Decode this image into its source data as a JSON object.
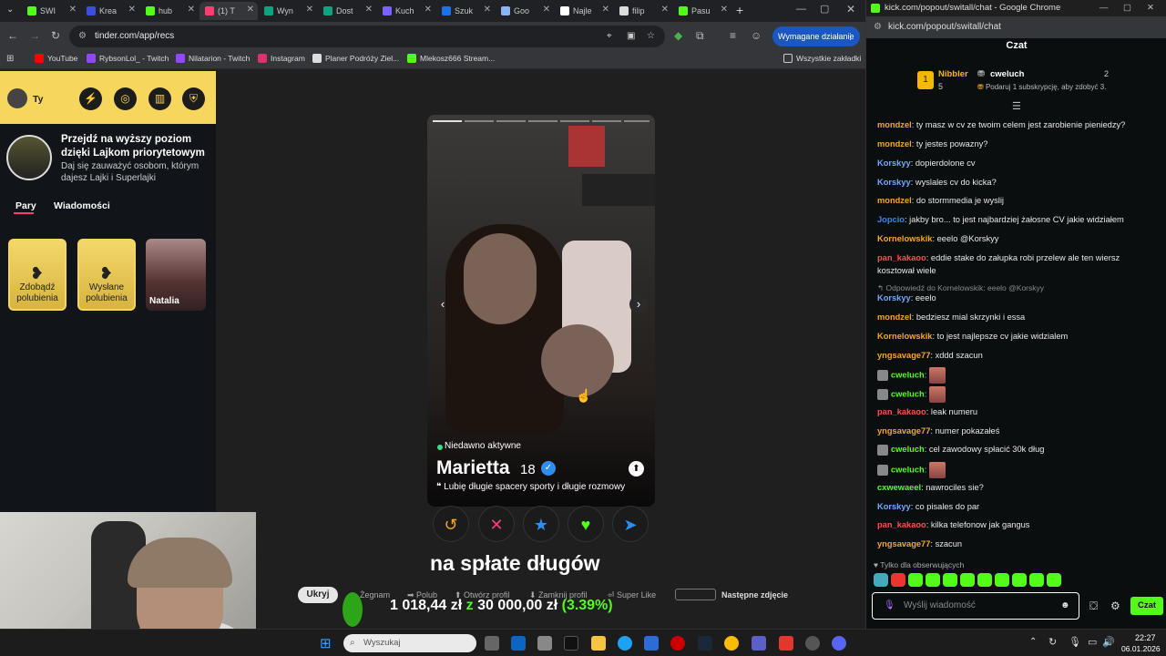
{
  "browser": {
    "tabs": [
      {
        "label": "SWI",
        "color": "#53fc18"
      },
      {
        "label": "Krea",
        "color": "#3c4ee0"
      },
      {
        "label": "hub",
        "color": "#53fc18"
      },
      {
        "label": "(1) T",
        "color": "#fe3c72"
      },
      {
        "label": "Wyn",
        "color": "#10a37f"
      },
      {
        "label": "Dost",
        "color": "#10a37f"
      },
      {
        "label": "Kuch",
        "color": "#7b61ff"
      },
      {
        "label": "Szuk",
        "color": "#1a73e8"
      },
      {
        "label": "Goo",
        "color": "#8ab4f8"
      },
      {
        "label": "Najle",
        "color": "#ffffff"
      },
      {
        "label": "filip",
        "color": "#dddddd"
      },
      {
        "label": "Pasu",
        "color": "#53fc18"
      }
    ],
    "url": "tinder.com/app/recs",
    "action_button": "Wymagane działanie",
    "bookmarks": [
      "YouTube",
      "RybsonLol_ - Twitch",
      "Nilatarion - Twitch",
      "Instagram",
      "Planer Podróży Ziel...",
      "Mlekosz666 Stream..."
    ],
    "all_bookmarks": "Wszystkie zakładki"
  },
  "tinder": {
    "user_label": "Ty",
    "promo_title": "Przejdź na wyższy poziom dzięki Lajkom priorytetowym",
    "promo_sub": "Daj się zauważyć osobom, którym dajesz Lajki i Superlajki",
    "tabs": [
      "Pary",
      "Wiadomości"
    ],
    "cards": [
      "Zdobądź polubienia",
      "Wysłane polubienia",
      "Natalia"
    ],
    "profile": {
      "status": "Niedawno aktywne",
      "name": "Marietta",
      "age": "18",
      "bio": "Lubię długie spacery sporty i długie rozmowy"
    }
  },
  "stream_overlay": {
    "caption": "na spłate długów",
    "hide_button": "Ukryj",
    "hints": [
      "Żegnam",
      "Polub",
      "Otwórz profil",
      "Zamknij profil",
      "Super Like"
    ],
    "next_photo": "Następne zdjęcie",
    "money_current": "1 018,44 zł",
    "money_sep": "z",
    "money_goal": "30 000,00 zł",
    "money_pct": "(3.39%)"
  },
  "taskbar": {
    "search_placeholder": "Wyszukaj",
    "time": "22:27",
    "date": "06.01.2026"
  },
  "chat": {
    "window_title": "kick.com/popout/switall/chat - Google Chrome",
    "url": "kick.com/popout/switall/chat",
    "header": "Czat",
    "leader1_name": "Nibbler",
    "leader1_count": "5",
    "leader2_name": "cweluch",
    "leader2_count": "2",
    "leader_sub": "Podaruj 1 subskrypcję, aby zdobyć 3.",
    "messages": [
      {
        "user": "mondzel",
        "color": "#f5a623",
        "text": ": ty masz w cv ze twoim celem jest zarobienie pieniedzy?"
      },
      {
        "user": "mondzel",
        "color": "#f5a623",
        "text": ": ty jestes powazny?"
      },
      {
        "user": "Korskyy",
        "color": "#6fa8ff",
        "text": ": dopierdolone cv"
      },
      {
        "user": "Korskyy",
        "color": "#6fa8ff",
        "text": ": wyslales cv do kicka?"
      },
      {
        "user": "mondzel",
        "color": "#f5a623",
        "text": ": do stormmedia je wyslij"
      },
      {
        "user": "Jopcio",
        "color": "#3b82f6",
        "text": ": jakby bro... to jest najbardziej żałosne CV jakie widziałem"
      },
      {
        "user": "Kornelowskik",
        "color": "#f5a623",
        "text": ": eeelo @Korskyy"
      },
      {
        "user": "pan_kakaoo",
        "color": "#ff4d4d",
        "text": ": eddie stake do załupka robi przelew ale ten wiersz kosztował wiele"
      },
      {
        "user": "",
        "color": "#888888",
        "text": "↰ Odpowiedź do Kornelowskik: eeelo @Korskyy"
      },
      {
        "user": "Korskyy",
        "color": "#6fa8ff",
        "text": ": eeelo"
      },
      {
        "user": "mondzel",
        "color": "#f5a623",
        "text": ": bedziesz mial skrzynki i essa"
      },
      {
        "user": "Kornelowskik",
        "color": "#f5a623",
        "text": ": to jest najlepsze cv jakie widzialem"
      },
      {
        "user": "yngsavage77",
        "color": "#f5a623",
        "text": ": xddd szacun"
      },
      {
        "user": "cweluch",
        "color": "#53fc18",
        "text": ":"
      },
      {
        "user": "cweluch",
        "color": "#53fc18",
        "text": ":"
      },
      {
        "user": "pan_kakaoo",
        "color": "#ff4d4d",
        "text": ": leak numeru"
      },
      {
        "user": "yngsavage77",
        "color": "#f5a623",
        "text": ": numer pokazałeś"
      },
      {
        "user": "cweluch",
        "color": "#53fc18",
        "text": ": cel zawodowy spłacić 30k dług"
      },
      {
        "user": "cweluch",
        "color": "#53fc18",
        "text": ":"
      },
      {
        "user": "cxwewaeel",
        "color": "#53fc18",
        "text": ": nawrociles sie?"
      },
      {
        "user": "Korskyy",
        "color": "#6fa8ff",
        "text": ": co pisales do par"
      },
      {
        "user": "pan_kakaoo",
        "color": "#ff4d4d",
        "text": ": kilka telefonow jak gangus"
      },
      {
        "user": "yngsavage77",
        "color": "#f5a623",
        "text": ": szacun"
      }
    ],
    "followers_only": "Tylko dla obserwujących",
    "input_placeholder": "Wyślij wiadomość",
    "send_label": "Czat"
  }
}
